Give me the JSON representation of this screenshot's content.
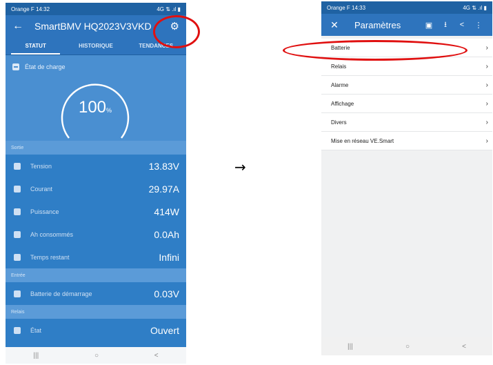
{
  "left_phone": {
    "status": {
      "carrier_time": "Orange F 14:32",
      "icons": "4G ⇅ .ıl ▮"
    },
    "app_bar": {
      "back": "←",
      "title": "SmartBMV HQ2023V3VKD",
      "gear": "⚙"
    },
    "tabs": [
      {
        "label": "STATUT"
      },
      {
        "label": "HISTORIQUE"
      },
      {
        "label": "TENDANCES"
      }
    ],
    "soc": {
      "label": "État de charge",
      "value": "100",
      "unit": "%",
      "fraction": 1.0
    },
    "sections": [
      {
        "header": "Sortie",
        "rows": [
          {
            "label": "Tension",
            "value": "13.83V"
          },
          {
            "label": "Courant",
            "value": "29.97A"
          },
          {
            "label": "Puissance",
            "value": "414W"
          },
          {
            "label": "Ah consommés",
            "value": "0.0Ah"
          },
          {
            "label": "Temps restant",
            "value": "Infini"
          }
        ]
      },
      {
        "header": "Entrée",
        "rows": [
          {
            "label": "Batterie de démarrage",
            "value": "0.03V"
          }
        ]
      },
      {
        "header": "Relais",
        "rows": [
          {
            "label": "État",
            "value": "Ouvert"
          }
        ]
      }
    ],
    "nav": {
      "recent": "|||",
      "home": "○",
      "back": "<"
    }
  },
  "arrow": "→",
  "right_phone": {
    "status": {
      "carrier_time": "Orange F 14:33",
      "icons": "4G ⇅ .ıl ▮"
    },
    "app_bar": {
      "close": "✕",
      "title": "Paramètres",
      "save": "▣",
      "download": "⭳",
      "share": "<",
      "more": "⋮"
    },
    "menu": [
      {
        "label": "Batterie",
        "chev": "›"
      },
      {
        "label": "Relais",
        "chev": "›"
      },
      {
        "label": "Alarme",
        "chev": "›"
      },
      {
        "label": "Affichage",
        "chev": "›"
      },
      {
        "label": "Divers",
        "chev": "›"
      },
      {
        "label": "Mise en réseau VE.Smart",
        "chev": "›"
      }
    ],
    "nav": {
      "recent": "|||",
      "home": "○",
      "back": "<"
    }
  },
  "colors": {
    "primary": "#2e74bd",
    "panel": "#4a8fd1",
    "annotation": "#e01010"
  }
}
